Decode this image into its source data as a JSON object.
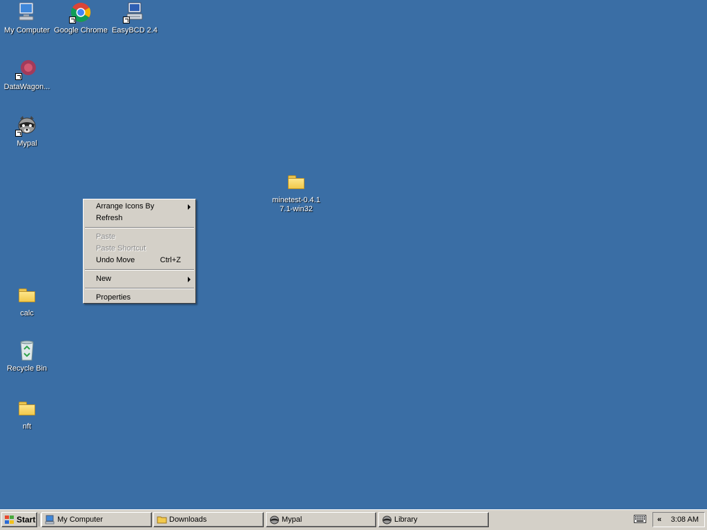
{
  "desktop": {
    "background_color": "#3a6ea5",
    "icons": [
      {
        "label": "My Computer",
        "icon": "my-computer-icon"
      },
      {
        "label": "Google Chrome",
        "icon": "chrome-icon"
      },
      {
        "label": "EasyBCD 2.4",
        "icon": "easybcd-icon"
      },
      {
        "label": "DataWagon...",
        "icon": "datawagon-icon"
      },
      {
        "label": "Mypal",
        "icon": "mypal-raccoon-icon"
      },
      {
        "label": "minetest-0.4.1\n7.1-win32",
        "icon": "folder-icon"
      },
      {
        "label": "calc",
        "icon": "folder-icon"
      },
      {
        "label": "Recycle Bin",
        "icon": "recycle-bin-icon"
      },
      {
        "label": "nft",
        "icon": "folder-icon"
      }
    ]
  },
  "context_menu": {
    "items": [
      {
        "label": "Arrange Icons By",
        "submenu": true
      },
      {
        "label": "Refresh"
      },
      {
        "label": "Paste",
        "disabled": true
      },
      {
        "label": "Paste Shortcut",
        "disabled": true
      },
      {
        "label": "Undo Move",
        "shortcut": "Ctrl+Z"
      },
      {
        "label": "New",
        "submenu": true
      },
      {
        "label": "Properties"
      }
    ]
  },
  "taskbar": {
    "start_label": "Start",
    "tasks": [
      {
        "label": "My Computer",
        "icon": "my-computer-icon"
      },
      {
        "label": "Downloads",
        "icon": "folder-icon"
      },
      {
        "label": "Mypal",
        "icon": "mypal-raccoon-icon"
      },
      {
        "label": "Library",
        "icon": "mypal-raccoon-icon"
      }
    ],
    "tray": {
      "chevron": "«",
      "clock": "3:08 AM",
      "icons": [
        "keyboard-icon"
      ]
    }
  }
}
